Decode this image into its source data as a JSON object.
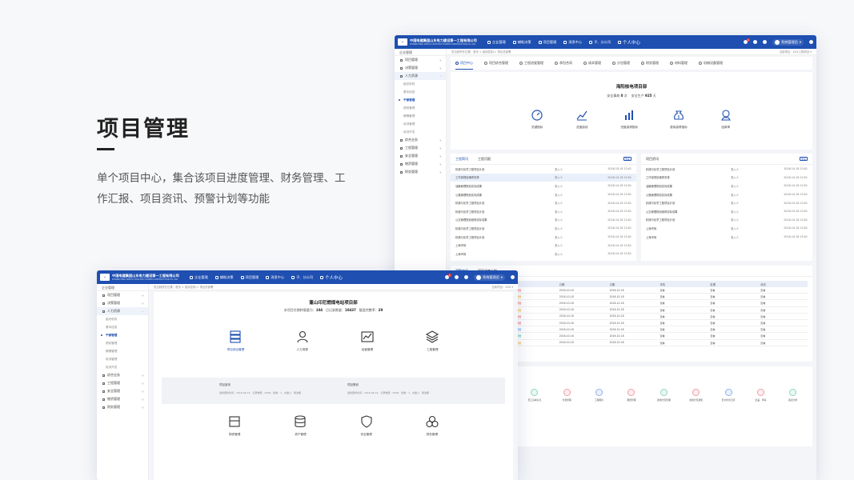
{
  "hero": {
    "title": "项目管理",
    "desc": "单个项目中心，集合该项目进度管理、财务管理、工作汇报、项目资讯、预警计划等功能"
  },
  "colors": {
    "brand": "#1e4fb1",
    "accent_red": "#e44444",
    "green": "#22aa88"
  },
  "topbar": {
    "company": "中国电建集团山东电力建设第一工程有限公司",
    "company_en": "POWERCHINA SEPCO1 ELECTRIC POWER CONSTRUCTION CO.,LTD.",
    "navs": [
      "企业管理",
      "辅助决策",
      "项目管理",
      "消息中心",
      "子、分公司",
      "个人中心"
    ],
    "badge": "1",
    "user": "系统管理员"
  },
  "sidebar": {
    "head": "企业管理",
    "items": [
      {
        "label": "项目管理"
      },
      {
        "label": "决策管理"
      },
      {
        "label": "人力资源"
      }
    ],
    "subs": [
      "组织机构",
      "基本信息",
      "干部管理",
      "绩效管理",
      "薪酬管理",
      "培训管理",
      "培训开发"
    ],
    "items2": [
      {
        "label": "综合业务"
      },
      {
        "label": "工程管理"
      },
      {
        "label": "安全管理"
      },
      {
        "label": "物资管理"
      },
      {
        "label": "财务管理"
      }
    ]
  },
  "w1": {
    "crumbs": "您当前所在位置：首页 > 费用控制 > 项目总部署",
    "crumbs_right": "当前项目：XXX工程项目",
    "tabs": [
      "项目中心",
      "项目综合管理",
      "工程进度管理",
      "承包合同",
      "成本管理",
      "分包管理",
      "财务管理",
      "材料管理",
      "机械设备管理"
    ],
    "project": {
      "name": "海阳核电项目部",
      "safety_label1": "安全事故",
      "safety_val1": "0",
      "safety_unit1": "次",
      "safety_label2": "安全生产",
      "safety_val2": "925",
      "safety_unit2": "天"
    },
    "metrics": [
      "关键指标",
      "进度曲线",
      "进度赢得指标",
      "费用赢得指标",
      "回款率"
    ],
    "news": {
      "tabs": [
        "工程简讯",
        "工程月报"
      ],
      "more": "更多",
      "rows": [
        {
          "t": "机械与化学工程项目计划",
          "a": "录入人",
          "d": "2016-10-18 15:01"
        },
        {
          "t": "工作量规划维修安排",
          "a": "录入人",
          "d": "2016-10-18 15:01"
        },
        {
          "t": "油膜管理规划实际成果",
          "a": "录入人",
          "d": "2016-10-18 15:01"
        },
        {
          "t": "公路管理规划实际成果",
          "a": "录入人",
          "d": "2016-10-18 15:01"
        },
        {
          "t": "机械与化学工程项目计划",
          "a": "录入人",
          "d": "2016-10-18 15:01"
        },
        {
          "t": "机械与化学工程项目计划",
          "a": "录入人",
          "d": "2016-10-18 15:01"
        },
        {
          "t": "公交管理规划维修实际成果",
          "a": "录入人",
          "d": "2016-10-18 15:01"
        },
        {
          "t": "机械与化学工程项目计划",
          "a": "录入人",
          "d": "2016-10-18 15:01"
        },
        {
          "t": "机械与化学工程项目计划",
          "a": "录入人",
          "d": "2016-10-18 15:01"
        },
        {
          "t": "上海市场",
          "a": "录入人",
          "d": "2016-10-18 15:01"
        },
        {
          "t": "上海市场",
          "a": "录入人",
          "d": "2016-10-18 15:01"
        }
      ]
    },
    "info": {
      "title": "项目资讯",
      "more": "更多",
      "rows": [
        {
          "t": "机械与化学工程项目计划",
          "a": "录入人",
          "d": "2016-10-18 15:01"
        },
        {
          "t": "工作量规划维修安排",
          "a": "录入人",
          "d": "2016-10-18 15:01"
        },
        {
          "t": "油膜管理规划实际成果",
          "a": "录入人",
          "d": "2016-10-18 15:01"
        },
        {
          "t": "公路管理规划实际成果",
          "a": "录入人",
          "d": "2016-10-18 15:01"
        },
        {
          "t": "机械与化学工程项目计划",
          "a": "录入人",
          "d": "2016-10-18 15:01"
        },
        {
          "t": "公交管理规划维修实际成果",
          "a": "录入人",
          "d": "2016-10-18 15:01"
        },
        {
          "t": "机械与化学工程项目计划",
          "a": "录入人",
          "d": "2016-10-18 15:01"
        },
        {
          "t": "上海市场",
          "a": "录入人",
          "d": "2016-10-18 15:01"
        },
        {
          "t": "上海市场",
          "a": "录入人",
          "d": "2016-10-18 15:01"
        }
      ]
    },
    "warn": {
      "tabs": [
        "预警信息",
        "项目进度计划"
      ],
      "headers": [
        "",
        "级别",
        "日期",
        "日期",
        "详情",
        "处理",
        "状态"
      ],
      "rows": [
        {
          "level": "红色预警",
          "cls": "r",
          "d1": "2016-10-18",
          "d2": "2016-10-18",
          "x": "查看",
          "y": "查看",
          "z": "查看"
        },
        {
          "level": "黄色预警",
          "cls": "y",
          "d1": "2016-10-18",
          "d2": "2016-10-18",
          "x": "查看",
          "y": "查看",
          "z": "查看"
        },
        {
          "level": "红色预警",
          "cls": "r",
          "d1": "2016-10-18",
          "d2": "2016-10-18",
          "x": "查看",
          "y": "查看",
          "z": "查看"
        },
        {
          "level": "黄色预警",
          "cls": "y",
          "d1": "2016-10-18",
          "d2": "2016-10-18",
          "x": "查看",
          "y": "查看",
          "z": "查看"
        },
        {
          "level": "红色预警",
          "cls": "r",
          "d1": "2016-10-18",
          "d2": "2016-10-18",
          "x": "查看",
          "y": "查看",
          "z": "查看"
        },
        {
          "level": "红色预警",
          "cls": "r",
          "d1": "2016-10-18",
          "d2": "2016-10-18",
          "x": "查看",
          "y": "查看",
          "z": "查看"
        },
        {
          "level": "蓝色预警",
          "cls": "b",
          "d1": "2016-10-18",
          "d2": "2016-10-18",
          "x": "查看",
          "y": "查看",
          "z": "查看"
        },
        {
          "level": "绿色预警",
          "cls": "g",
          "d1": "2016-10-18",
          "d2": "2016-10-18",
          "x": "查看",
          "y": "查看",
          "z": "查看"
        },
        {
          "level": "黄色预警",
          "cls": "y",
          "d1": "2016-10-18",
          "d2": "2016-10-18",
          "x": "查看",
          "y": "查看",
          "z": "查看"
        }
      ]
    },
    "quick": [
      "通讯公告",
      "项目人员通讯管理",
      "员工基本信息",
      "考勤管理",
      "工程图片",
      "图纸管理",
      "通用分包管理",
      "通用分包通知",
      "安全检查记录",
      "出差、申请",
      "报表分析"
    ]
  },
  "w2": {
    "crumbs": "您当前所在位置：首页 > 费用控制 > 项目总部署",
    "crumbs_right": "当前项目：XXX",
    "project": {
      "name": "蓬山印尼燃煤电站项目部",
      "l1": "本项目任期转载量为：",
      "v1": "104",
      "l2": "日记录数量：",
      "v2": "10437",
      "l3": "截面完整率：",
      "v3": "29"
    },
    "row1": [
      "项目综合管理",
      "人力资源",
      "经营管理",
      "工程管理"
    ],
    "plan_a": {
      "title": "项目宣传",
      "meta": "最新更新时间：2016-06-15，记录数量：2008，权重：1，文章人：杨洁娜"
    },
    "plan_b": {
      "title": "项目策划",
      "meta": "最新更新时间：2016-06-01，记录数量：2008，权重：1，文章人：杨洁娜"
    },
    "row2": [
      "物资管理",
      "资产管理",
      "安全管理",
      "财务管理"
    ]
  }
}
